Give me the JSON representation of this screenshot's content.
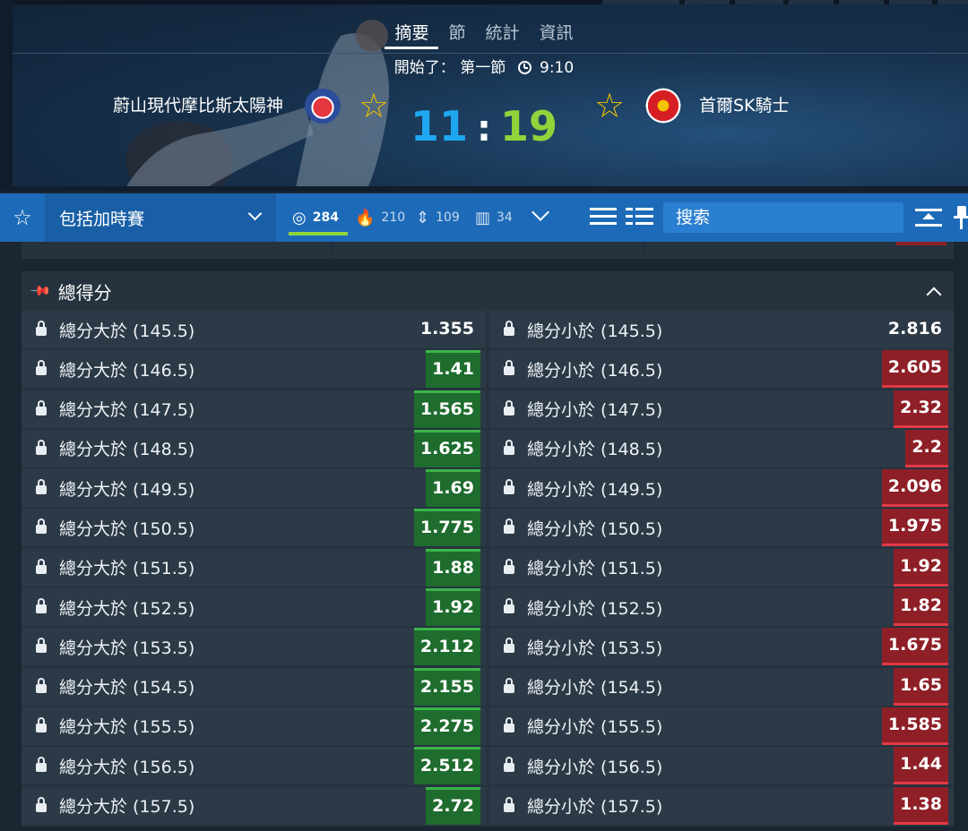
{
  "header": {
    "tabs": [
      "摘要",
      "節",
      "統計",
      "資訊"
    ],
    "active_tab": 0,
    "status_prefix": "開始了：",
    "period": "第一節",
    "clock": "9:10",
    "home_team": "蔚山現代摩比斯太陽神",
    "away_team": "首爾SK騎士",
    "home_score": "11",
    "score_separator": ":",
    "away_score": "19",
    "home_logo_text": "PHOEBUS",
    "away_logo_text": "Knights"
  },
  "toolbar": {
    "overtime_select": "包括加時賽",
    "counts": [
      {
        "icon": "target-icon",
        "value": "284"
      },
      {
        "icon": "fire-icon",
        "value": "210"
      },
      {
        "icon": "sort-icon",
        "value": "109"
      },
      {
        "icon": "bars-icon",
        "value": "34"
      }
    ],
    "search_placeholder": "搜索"
  },
  "market": {
    "title": "總得分",
    "rows": [
      {
        "over_label": "總分大於 (145.5)",
        "over_odds": "1.355",
        "over_trend": "plain",
        "under_label": "總分小於 (145.5)",
        "under_odds": "2.816",
        "under_trend": "plain"
      },
      {
        "over_label": "總分大於 (146.5)",
        "over_odds": "1.41",
        "over_trend": "up",
        "under_label": "總分小於 (146.5)",
        "under_odds": "2.605",
        "under_trend": "down"
      },
      {
        "over_label": "總分大於 (147.5)",
        "over_odds": "1.565",
        "over_trend": "up",
        "under_label": "總分小於 (147.5)",
        "under_odds": "2.32",
        "under_trend": "down"
      },
      {
        "over_label": "總分大於 (148.5)",
        "over_odds": "1.625",
        "over_trend": "up",
        "under_label": "總分小於 (148.5)",
        "under_odds": "2.2",
        "under_trend": "down"
      },
      {
        "over_label": "總分大於 (149.5)",
        "over_odds": "1.69",
        "over_trend": "up",
        "under_label": "總分小於 (149.5)",
        "under_odds": "2.096",
        "under_trend": "down"
      },
      {
        "over_label": "總分大於 (150.5)",
        "over_odds": "1.775",
        "over_trend": "up",
        "under_label": "總分小於 (150.5)",
        "under_odds": "1.975",
        "under_trend": "down"
      },
      {
        "over_label": "總分大於 (151.5)",
        "over_odds": "1.88",
        "over_trend": "up",
        "under_label": "總分小於 (151.5)",
        "under_odds": "1.92",
        "under_trend": "down"
      },
      {
        "over_label": "總分大於 (152.5)",
        "over_odds": "1.92",
        "over_trend": "up",
        "under_label": "總分小於 (152.5)",
        "under_odds": "1.82",
        "under_trend": "down"
      },
      {
        "over_label": "總分大於 (153.5)",
        "over_odds": "2.112",
        "over_trend": "up",
        "under_label": "總分小於 (153.5)",
        "under_odds": "1.675",
        "under_trend": "down"
      },
      {
        "over_label": "總分大於 (154.5)",
        "over_odds": "2.155",
        "over_trend": "up",
        "under_label": "總分小於 (154.5)",
        "under_odds": "1.65",
        "under_trend": "down"
      },
      {
        "over_label": "總分大於 (155.5)",
        "over_odds": "2.275",
        "over_trend": "up",
        "under_label": "總分小於 (155.5)",
        "under_odds": "1.585",
        "under_trend": "down"
      },
      {
        "over_label": "總分大於 (156.5)",
        "over_odds": "2.512",
        "over_trend": "up",
        "under_label": "總分小於 (156.5)",
        "under_odds": "1.44",
        "under_trend": "down"
      },
      {
        "over_label": "總分大於 (157.5)",
        "over_odds": "2.72",
        "over_trend": "up",
        "under_label": "總分小於 (157.5)",
        "under_odds": "1.38",
        "under_trend": "down"
      }
    ]
  },
  "colors": {
    "home_score": "#1ea7f0",
    "away_score": "#8fd43a",
    "toolbar_bg": "#1d6bb8",
    "odds_up": "#1e6c2e",
    "odds_down": "#8e1f27",
    "star": "#f2c100"
  }
}
